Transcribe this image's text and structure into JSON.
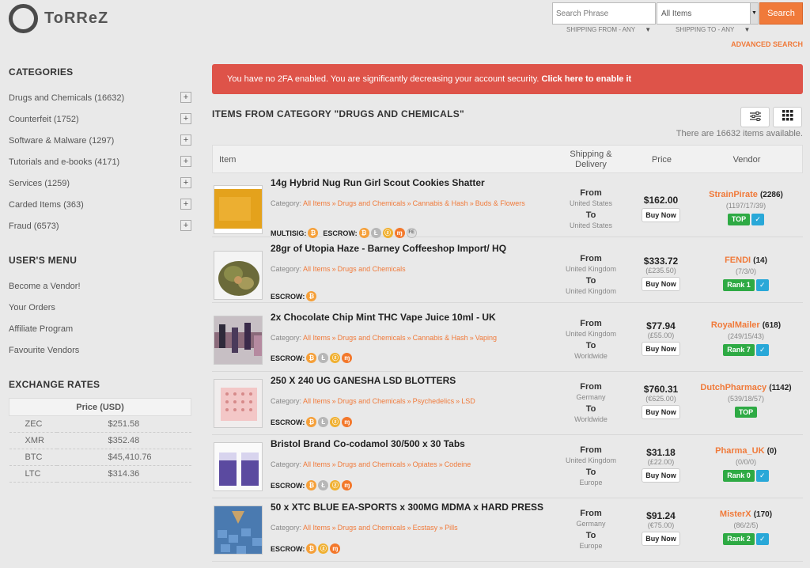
{
  "brand": {
    "name": "ToRReZ"
  },
  "search": {
    "placeholder": "Search Phrase",
    "category_selected": "All Items",
    "button": "Search",
    "shipping_from": "SHIPPING FROM - ANY",
    "shipping_to": "SHIPPING TO - ANY",
    "advanced": "ADVANCED SEARCH"
  },
  "sidebar": {
    "categories_heading": "CATEGORIES",
    "categories": [
      {
        "label": "Drugs and Chemicals (16632)"
      },
      {
        "label": "Counterfeit (1752)"
      },
      {
        "label": "Software & Malware (1297)"
      },
      {
        "label": "Tutorials and e-books (4171)"
      },
      {
        "label": "Services (1259)"
      },
      {
        "label": "Carded Items (363)"
      },
      {
        "label": "Fraud (6573)"
      }
    ],
    "plus": "+",
    "menu_heading": "USER'S MENU",
    "menu": [
      {
        "label": "Become a Vendor!"
      },
      {
        "label": "Your Orders"
      },
      {
        "label": "Affiliate Program"
      },
      {
        "label": "Favourite Vendors"
      }
    ],
    "rates_heading": "EXCHANGE RATES",
    "rates_header": "Price (USD)",
    "rates": [
      {
        "coin": "ZEC",
        "price": "$251.58"
      },
      {
        "coin": "XMR",
        "price": "$352.48"
      },
      {
        "coin": "BTC",
        "price": "$45,410.76"
      },
      {
        "coin": "LTC",
        "price": "$314.36"
      }
    ]
  },
  "alert": {
    "text": "You have no 2FA enabled. You are significantly decreasing your account security.",
    "link": "Click here to enable it"
  },
  "main": {
    "title": "ITEMS FROM CATEGORY \"DRUGS AND CHEMICALS\"",
    "count_text": "There are 16632 items available.",
    "columns": {
      "item": "Item",
      "shipping_line1": "Shipping &",
      "shipping_line2": "Delivery",
      "price": "Price",
      "vendor": "Vendor"
    },
    "labels": {
      "category": "Category:",
      "multisig": "MULTISIG:",
      "escrow": "ESCROW:",
      "from": "From",
      "to": "To",
      "buy": "Buy Now"
    },
    "coins": {
      "btc": "₿",
      "ltc": "Ł",
      "zec": "ⓩ",
      "xmr": "ɱ",
      "fe": "FE"
    },
    "separator": "»",
    "listings": [
      {
        "title": "14g Hybrid Nug Run Girl Scout Cookies Shatter",
        "crumbs": [
          "All Items",
          "Drugs and Chemicals",
          "Cannabis & Hash",
          "Buds & Flowers"
        ],
        "from": "United States",
        "to": "United States",
        "price": "$162.00",
        "price_sub": "",
        "vendor": "StrainPirate",
        "reviews": "(2286)",
        "stats": "(1197/17/39)",
        "rank": "TOP",
        "verified": true
      },
      {
        "title": "28gr of Utopia Haze - Barney Coffeeshop Import/ HQ",
        "crumbs": [
          "All Items",
          "Drugs and Chemicals"
        ],
        "from": "United Kingdom",
        "to": "United Kingdom",
        "price": "$333.72",
        "price_sub": "(£235.50)",
        "vendor": "FENDI",
        "reviews": "(14)",
        "stats": "(7/3/0)",
        "rank": "Rank 1",
        "verified": true
      },
      {
        "title": "2x Chocolate Chip Mint THC Vape Juice 10ml - UK",
        "crumbs": [
          "All Items",
          "Drugs and Chemicals",
          "Cannabis & Hash",
          "Vaping"
        ],
        "from": "United Kingdom",
        "to": "Worldwide",
        "price": "$77.94",
        "price_sub": "(£55.00)",
        "vendor": "RoyalMailer",
        "reviews": "(618)",
        "stats": "(249/15/43)",
        "rank": "Rank 7",
        "verified": true
      },
      {
        "title": "250 X 240 UG GANESHA LSD BLOTTERS",
        "crumbs": [
          "All Items",
          "Drugs and Chemicals",
          "Psychedelics",
          "LSD"
        ],
        "from": "Germany",
        "to": "Worldwide",
        "price": "$760.31",
        "price_sub": "(€625.00)",
        "vendor": "DutchPharmacy",
        "reviews": "(1142)",
        "stats": "(539/18/57)",
        "rank": "TOP",
        "verified": false
      },
      {
        "title": "Bristol Brand Co-codamol 30/500 x 30 Tabs",
        "crumbs": [
          "All Items",
          "Drugs and Chemicals",
          "Opiates",
          "Codeine"
        ],
        "from": "United Kingdom",
        "to": "Europe",
        "price": "$31.18",
        "price_sub": "(£22.00)",
        "vendor": "Pharma_UK",
        "reviews": "(0)",
        "stats": "(0/0/0)",
        "rank": "Rank 0",
        "verified": true
      },
      {
        "title": "50 x XTC BLUE EA-SPORTS x 300MG MDMA x HARD PRESS",
        "crumbs": [
          "All Items",
          "Drugs and Chemicals",
          "Ecstasy",
          "Pills"
        ],
        "from": "Germany",
        "to": "Europe",
        "price": "$91.24",
        "price_sub": "(€75.00)",
        "vendor": "MisterX",
        "reviews": "(170)",
        "stats": "(86/2/5)",
        "rank": "Rank 2",
        "verified": true
      }
    ]
  },
  "colors": {
    "accent": "#f07a3a",
    "alert": "#de5349",
    "rank_green": "#2eaa44",
    "verified_blue": "#29a8d8"
  }
}
